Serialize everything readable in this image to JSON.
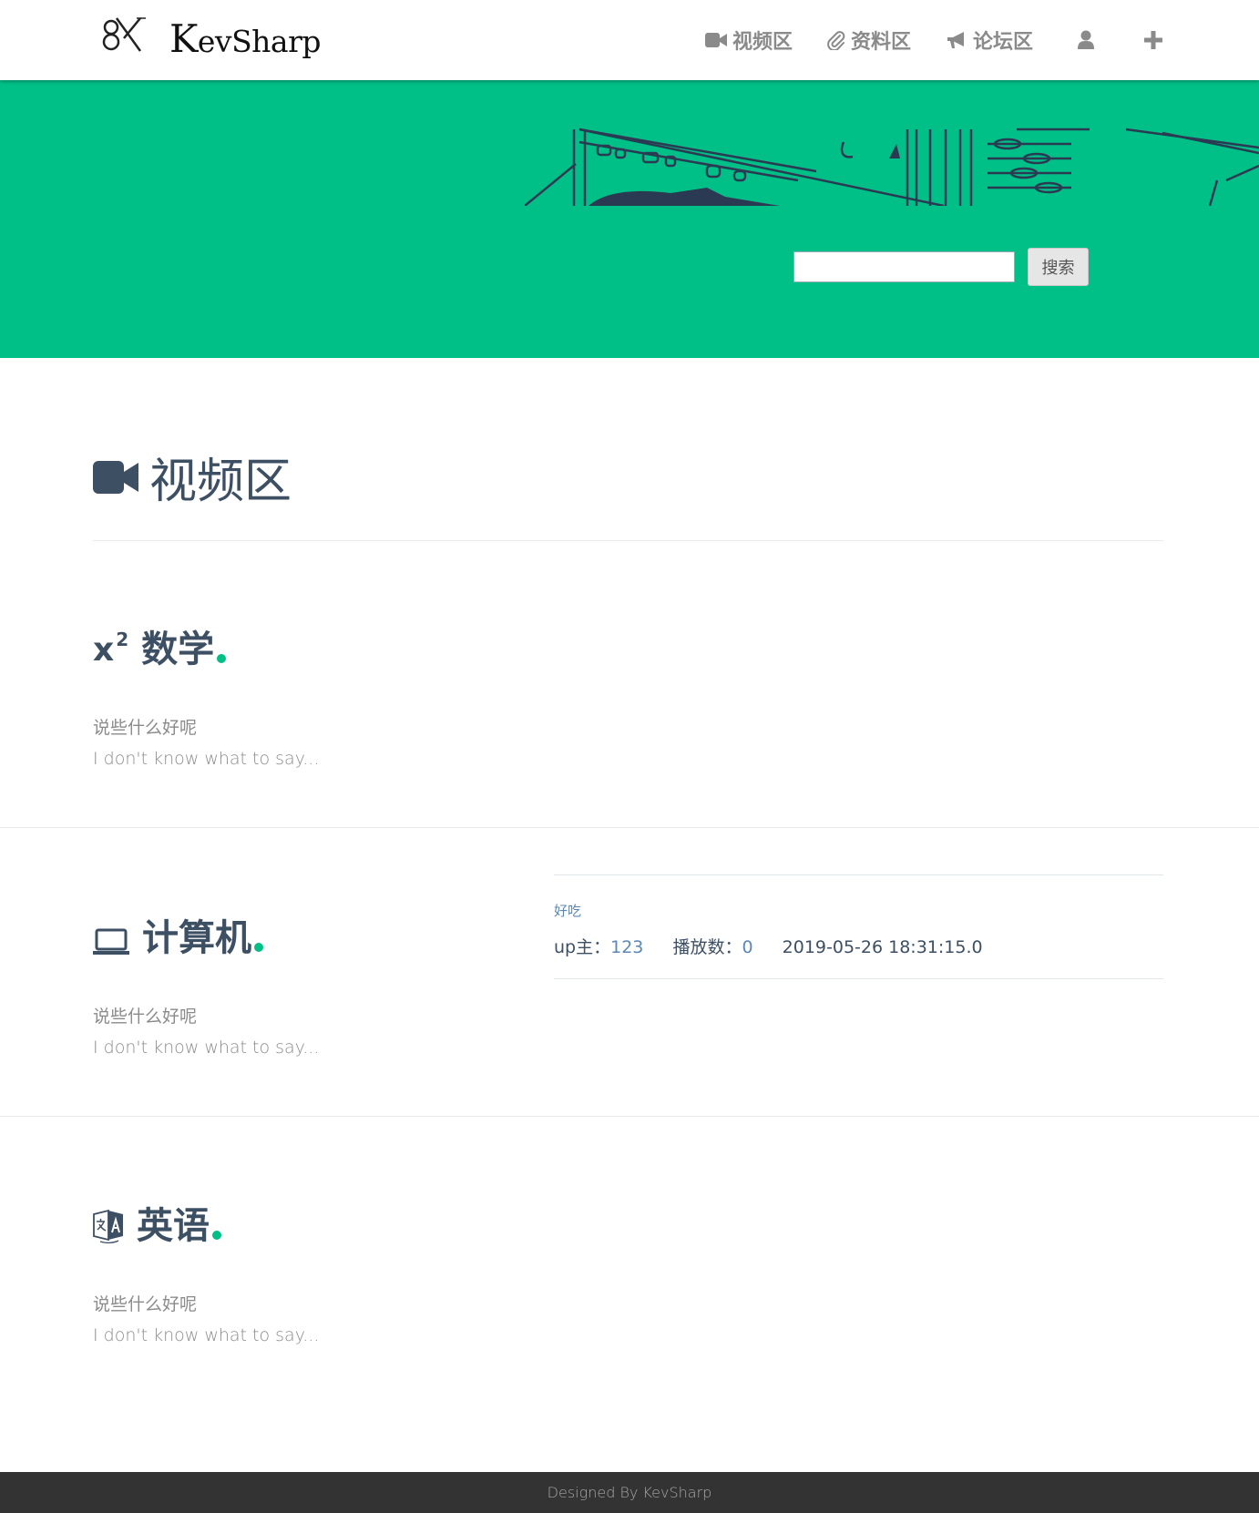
{
  "header": {
    "logo_text": "KevSharp",
    "nav": [
      {
        "label": "视频区",
        "icon": "video-camera-icon"
      },
      {
        "label": "资料区",
        "icon": "paperclip-icon"
      },
      {
        "label": "论坛区",
        "icon": "bullhorn-icon"
      },
      {
        "label": "",
        "icon": "user-icon"
      },
      {
        "label": "",
        "icon": "plus-icon"
      }
    ]
  },
  "banner": {
    "background_color": "#00bf87",
    "search": {
      "value": "",
      "placeholder": "",
      "button_label": "搜索"
    }
  },
  "page": {
    "title": "视频区",
    "title_icon": "video-camera-icon"
  },
  "subjects": [
    {
      "name": "数学",
      "icon": "superscript-icon",
      "icon_text": "x",
      "icon_sup": "2",
      "desc_cn": "说些什么好呢",
      "desc_en": "I don't know what to say..."
    },
    {
      "name": "计算机",
      "icon": "laptop-icon",
      "desc_cn": "说些什么好呢",
      "desc_en": "I don't know what to say..."
    },
    {
      "name": "英语",
      "icon": "translate-icon",
      "desc_cn": "说些什么好呢",
      "desc_en": "I don't know what to say..."
    }
  ],
  "videos": [
    {
      "title": "好吃",
      "uploader_label": "up主：",
      "uploader": "123",
      "plays_label": "播放数：",
      "plays": "0",
      "date": "2019-05-26 18:31:15.0"
    }
  ],
  "footer": {
    "text": "Designed By KevSharp"
  },
  "colors": {
    "accent": "#00bf87",
    "text": "#3d4f63",
    "link": "#5b88b5",
    "footer_bg": "#333333"
  }
}
